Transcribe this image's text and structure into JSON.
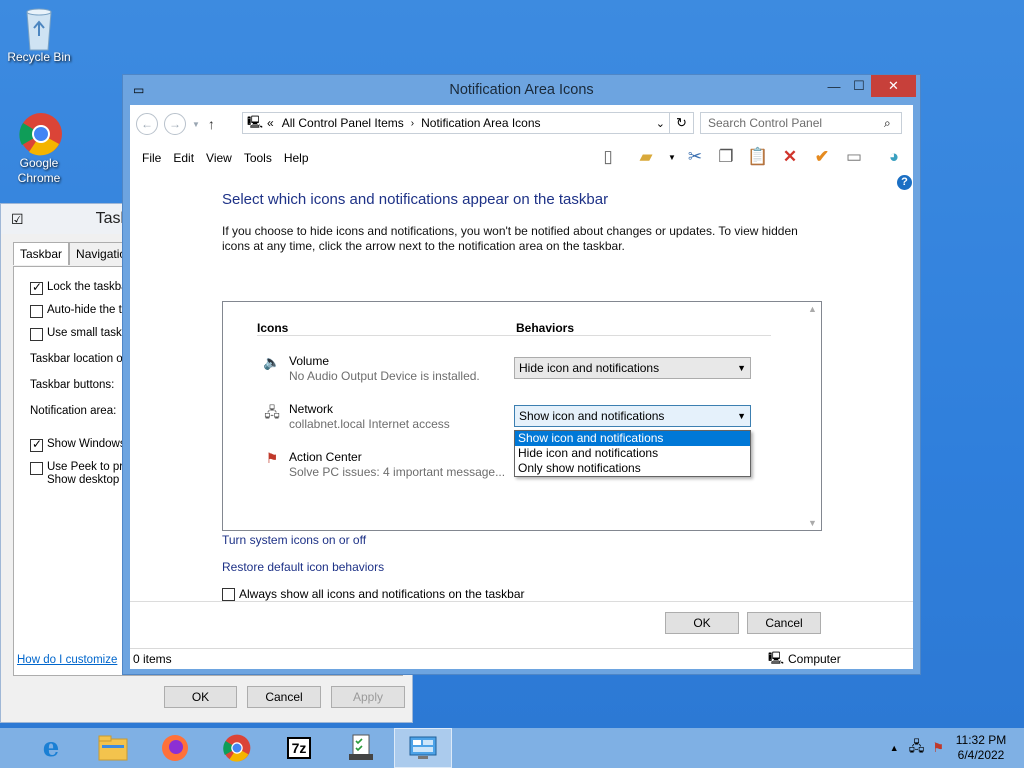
{
  "desktop": {
    "icons": [
      {
        "label": "Recycle Bin",
        "icon": "recycle-bin-icon"
      },
      {
        "label": "Google Chrome",
        "icon": "chrome-icon"
      }
    ]
  },
  "taskbar_props": {
    "title": "Task",
    "tabs": [
      "Taskbar",
      "Navigation"
    ],
    "rows": [
      {
        "label": "Lock the taskbar",
        "checked": true
      },
      {
        "label": "Auto-hide the ta",
        "checked": false
      },
      {
        "label": "Use small taskba",
        "checked": false
      },
      {
        "label": "Taskbar location on"
      },
      {
        "label": "Taskbar buttons:"
      },
      {
        "label": "Notification area:"
      },
      {
        "label": "Show Windows S",
        "checked": true
      },
      {
        "label": "Use Peek to prev",
        "label2": "Show desktop bu",
        "checked": false
      }
    ],
    "link": "How do I customize",
    "buttons": {
      "ok": "OK",
      "cancel": "Cancel",
      "apply": "Apply"
    }
  },
  "window": {
    "title": "Notification Area Icons",
    "controls": {
      "minimize": "—",
      "maximize": "☐",
      "close": "✕"
    },
    "address": {
      "prefix": "«",
      "crumbs": [
        "All Control Panel Items",
        "Notification Area Icons"
      ]
    },
    "search_placeholder": "Search Control Panel",
    "menu": [
      "File",
      "Edit",
      "View",
      "Tools",
      "Help"
    ],
    "heading": "Select which icons and notifications appear on the taskbar",
    "description": "If you choose to hide icons and notifications, you won't be notified about changes or updates. To view hidden icons at any time, click the arrow next to the notification area on the taskbar.",
    "columns": {
      "icons": "Icons",
      "behaviors": "Behaviors"
    },
    "items": [
      {
        "name": "Volume",
        "sub": "No Audio Output Device is installed.",
        "behavior": "Hide icon and notifications"
      },
      {
        "name": "Network",
        "sub": "collabnet.local Internet access",
        "behavior": "Show icon and notifications"
      },
      {
        "name": "Action Center",
        "sub": "Solve PC issues: 4 important message..."
      }
    ],
    "dropdown_options": [
      "Show icon and notifications",
      "Hide icon and notifications",
      "Only show notifications"
    ],
    "dropdown_selected": "Show icon and notifications",
    "links": [
      "Turn system icons on or off",
      "Restore default icon behaviors"
    ],
    "always_show": "Always show all icons and notifications on the taskbar",
    "ok": "OK",
    "cancel": "Cancel",
    "status": {
      "items": "0 items",
      "computer": "Computer"
    }
  },
  "clock": {
    "time": "11:32 PM",
    "date": "6/4/2022"
  },
  "taskbar_apps": [
    "internet-explorer-icon",
    "file-explorer-icon",
    "firefox-icon",
    "chrome-icon",
    "7zip-icon",
    "task-manager-icon",
    "control-panel-icon"
  ],
  "accent": "#1e3287",
  "selection_color": "#0078d7"
}
